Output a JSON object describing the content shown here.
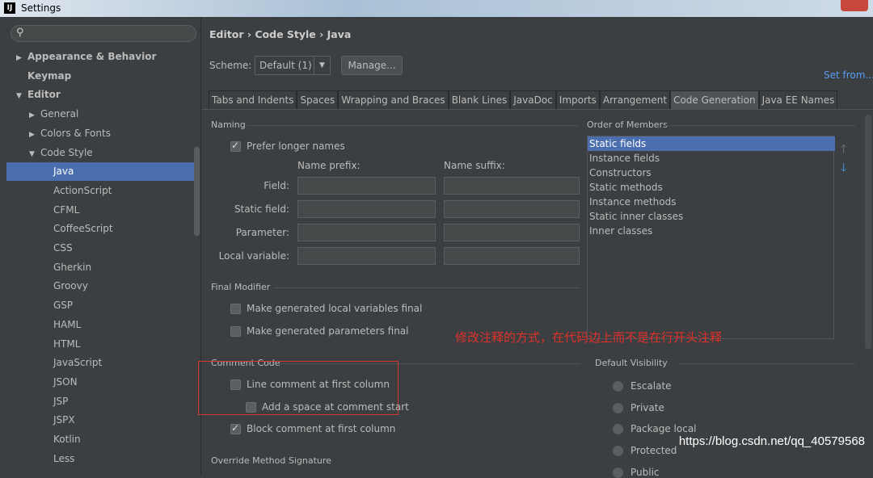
{
  "window": {
    "title": "Settings",
    "logo": "IJ"
  },
  "sidebar": {
    "search_placeholder": "",
    "items": [
      {
        "label": "Appearance & Behavior",
        "level": 0,
        "arrow": "▶",
        "bold": true
      },
      {
        "label": "Keymap",
        "level": 0,
        "arrow": "",
        "bold": true
      },
      {
        "label": "Editor",
        "level": 0,
        "arrow": "▼",
        "bold": true
      },
      {
        "label": "General",
        "level": 1,
        "arrow": "▶"
      },
      {
        "label": "Colors & Fonts",
        "level": 1,
        "arrow": "▶"
      },
      {
        "label": "Code Style",
        "level": 1,
        "arrow": "▼"
      },
      {
        "label": "Java",
        "level": 2,
        "arrow": "",
        "selected": true
      },
      {
        "label": "ActionScript",
        "level": 2,
        "arrow": ""
      },
      {
        "label": "CFML",
        "level": 2,
        "arrow": ""
      },
      {
        "label": "CoffeeScript",
        "level": 2,
        "arrow": ""
      },
      {
        "label": "CSS",
        "level": 2,
        "arrow": ""
      },
      {
        "label": "Gherkin",
        "level": 2,
        "arrow": ""
      },
      {
        "label": "Groovy",
        "level": 2,
        "arrow": ""
      },
      {
        "label": "GSP",
        "level": 2,
        "arrow": ""
      },
      {
        "label": "HAML",
        "level": 2,
        "arrow": ""
      },
      {
        "label": "HTML",
        "level": 2,
        "arrow": ""
      },
      {
        "label": "JavaScript",
        "level": 2,
        "arrow": ""
      },
      {
        "label": "JSON",
        "level": 2,
        "arrow": ""
      },
      {
        "label": "JSP",
        "level": 2,
        "arrow": ""
      },
      {
        "label": "JSPX",
        "level": 2,
        "arrow": ""
      },
      {
        "label": "Kotlin",
        "level": 2,
        "arrow": ""
      },
      {
        "label": "Less",
        "level": 2,
        "arrow": ""
      }
    ]
  },
  "main": {
    "breadcrumb": "Editor › Code Style › Java",
    "scheme_label": "Scheme:",
    "scheme_value": "Default (1)",
    "manage": "Manage...",
    "set_from": "Set from...",
    "tabs": [
      "Tabs and Indents",
      "Spaces",
      "Wrapping and Braces",
      "Blank Lines",
      "JavaDoc",
      "Imports",
      "Arrangement",
      "Code Generation",
      "Java EE Names"
    ],
    "active_tab": "Code Generation",
    "naming": {
      "title": "Naming",
      "prefer_longer": "Prefer longer names",
      "prefer_checked": true,
      "prefix": "Name prefix:",
      "suffix": "Name suffix:",
      "rows": [
        "Field:",
        "Static field:",
        "Parameter:",
        "Local variable:"
      ]
    },
    "order": {
      "title": "Order of Members",
      "items": [
        "Static fields",
        "Instance fields",
        "Constructors",
        "Static methods",
        "Instance methods",
        "Static inner classes",
        "Inner classes"
      ],
      "selected": "Static fields"
    },
    "final_modifier": {
      "title": "Final Modifier",
      "items": [
        "Make generated local variables final",
        "Make generated parameters final"
      ]
    },
    "comment_code": {
      "title": "Comment Code",
      "line": "Line comment at first column",
      "space": "Add a space at comment start",
      "block": "Block comment at first column",
      "block_checked": true
    },
    "visibility": {
      "title": "Default Visibility",
      "items": [
        "Escalate",
        "Private",
        "Package local",
        "Protected",
        "Public"
      ]
    },
    "override": "Override Method Signature",
    "annotation": "修改注释的方式，在代码边上而不是在行开头注释",
    "watermark": "https://blog.csdn.net/qq_40579568"
  }
}
